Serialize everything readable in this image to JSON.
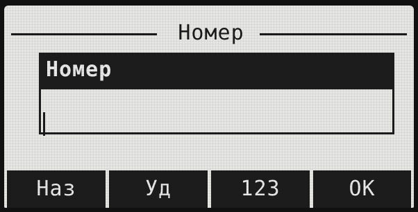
{
  "screen": {
    "title": "Номер"
  },
  "field": {
    "label": "Номер",
    "value": ""
  },
  "softkeys": [
    {
      "label": "Наз"
    },
    {
      "label": "Уд"
    },
    {
      "label": "123"
    },
    {
      "label": "OK"
    }
  ],
  "colors": {
    "lcd_background": "#e6e6e3",
    "lcd_foreground": "#1c1c1c",
    "bezel": "#111111"
  }
}
